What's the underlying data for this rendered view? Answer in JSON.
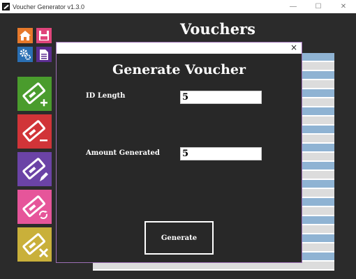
{
  "window": {
    "title": "Voucher Generator v1.3.0",
    "controls": {
      "minimize": "—",
      "maximize": "☐",
      "close": "✕"
    }
  },
  "background": {
    "heading": "Vouchers",
    "table_rows": [
      "blue",
      "grey",
      "blue",
      "grey",
      "blue",
      "grey",
      "blue",
      "grey",
      "blue",
      "grey",
      "blue",
      "grey",
      "blue",
      "grey",
      "blue",
      "grey",
      "blue",
      "grey",
      "blue",
      "grey",
      "blue",
      "grey",
      "blue",
      "grey"
    ],
    "row_colors": {
      "blue": "#8fb3d3",
      "grey": "#dcdcdc"
    }
  },
  "sidebar": {
    "small_icons": [
      "home-icon",
      "save-icon",
      "settings-icon",
      "document-icon"
    ],
    "tiles": [
      {
        "icon": "add-voucher-icon",
        "color": "#4a9c2d"
      },
      {
        "icon": "remove-voucher-icon",
        "color": "#d13438"
      },
      {
        "icon": "edit-voucher-icon",
        "color": "#6b43a6"
      },
      {
        "icon": "refresh-voucher-icon",
        "color": "#e6559a"
      },
      {
        "icon": "delete-voucher-icon",
        "color": "#c9b03a"
      }
    ]
  },
  "dialog": {
    "close_glyph": "×",
    "heading": "Generate Voucher",
    "id_length_label": "ID Length",
    "id_length_value": "5",
    "amount_label": "Amount Generated",
    "amount_value": "5",
    "generate_label": "Generate",
    "border_color": "#9c6fb5"
  }
}
